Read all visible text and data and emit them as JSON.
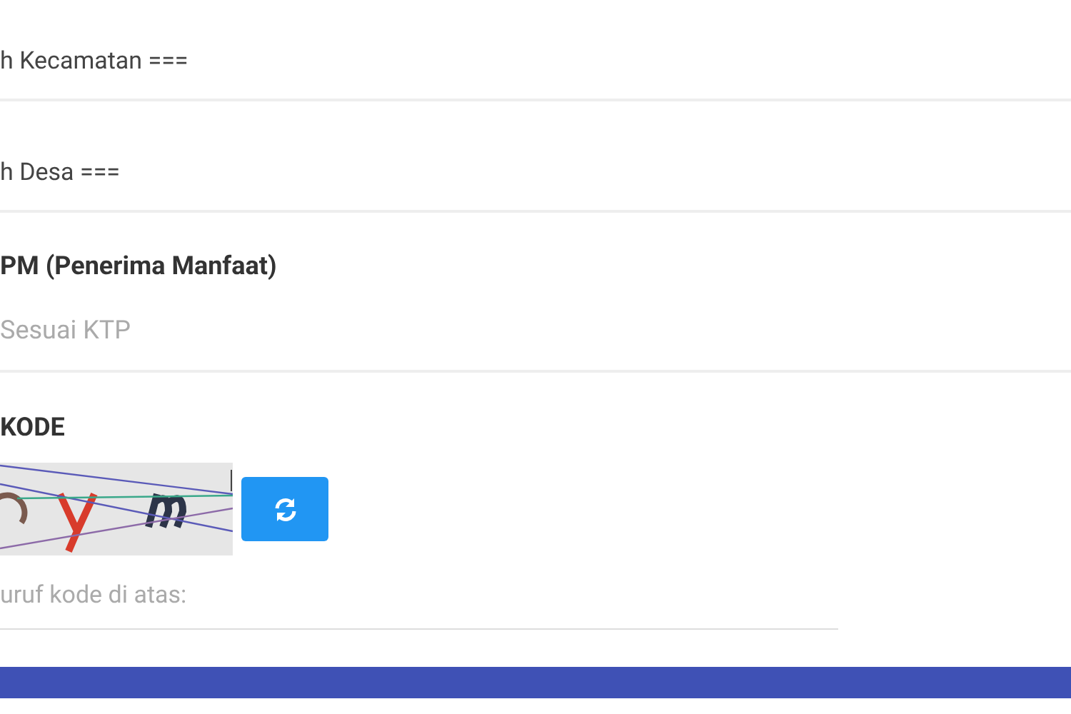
{
  "kecamatan_select": {
    "value": "h Kecamatan ==="
  },
  "desa_select": {
    "value": "h Desa ==="
  },
  "name_field": {
    "label": "PM (Penerima Manfaat)",
    "placeholder": "Sesuai KTP"
  },
  "captcha": {
    "label": "KODE",
    "code_field": {
      "placeholder": "uruf kode di atas:"
    }
  }
}
